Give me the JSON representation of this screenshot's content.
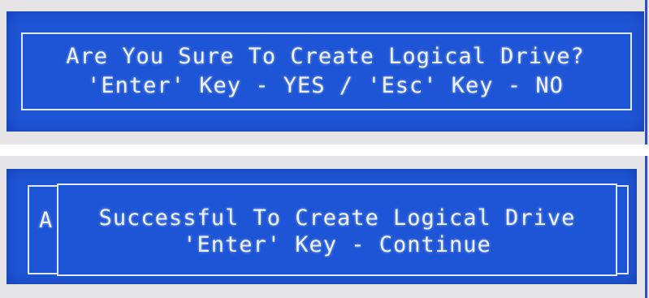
{
  "confirm_dialog": {
    "question": "Are You Sure To Create Logical Drive?",
    "options": "'Enter' Key - YES / 'Esc' Key - NO"
  },
  "result_dialog": {
    "background_letter": "A",
    "message": "Successful To Create Logical Drive",
    "options": "'Enter' Key - Continue"
  },
  "colors": {
    "dialog_blue": "#1e55d6",
    "text": "#eef2ff",
    "frame": "#dfe6ff"
  }
}
